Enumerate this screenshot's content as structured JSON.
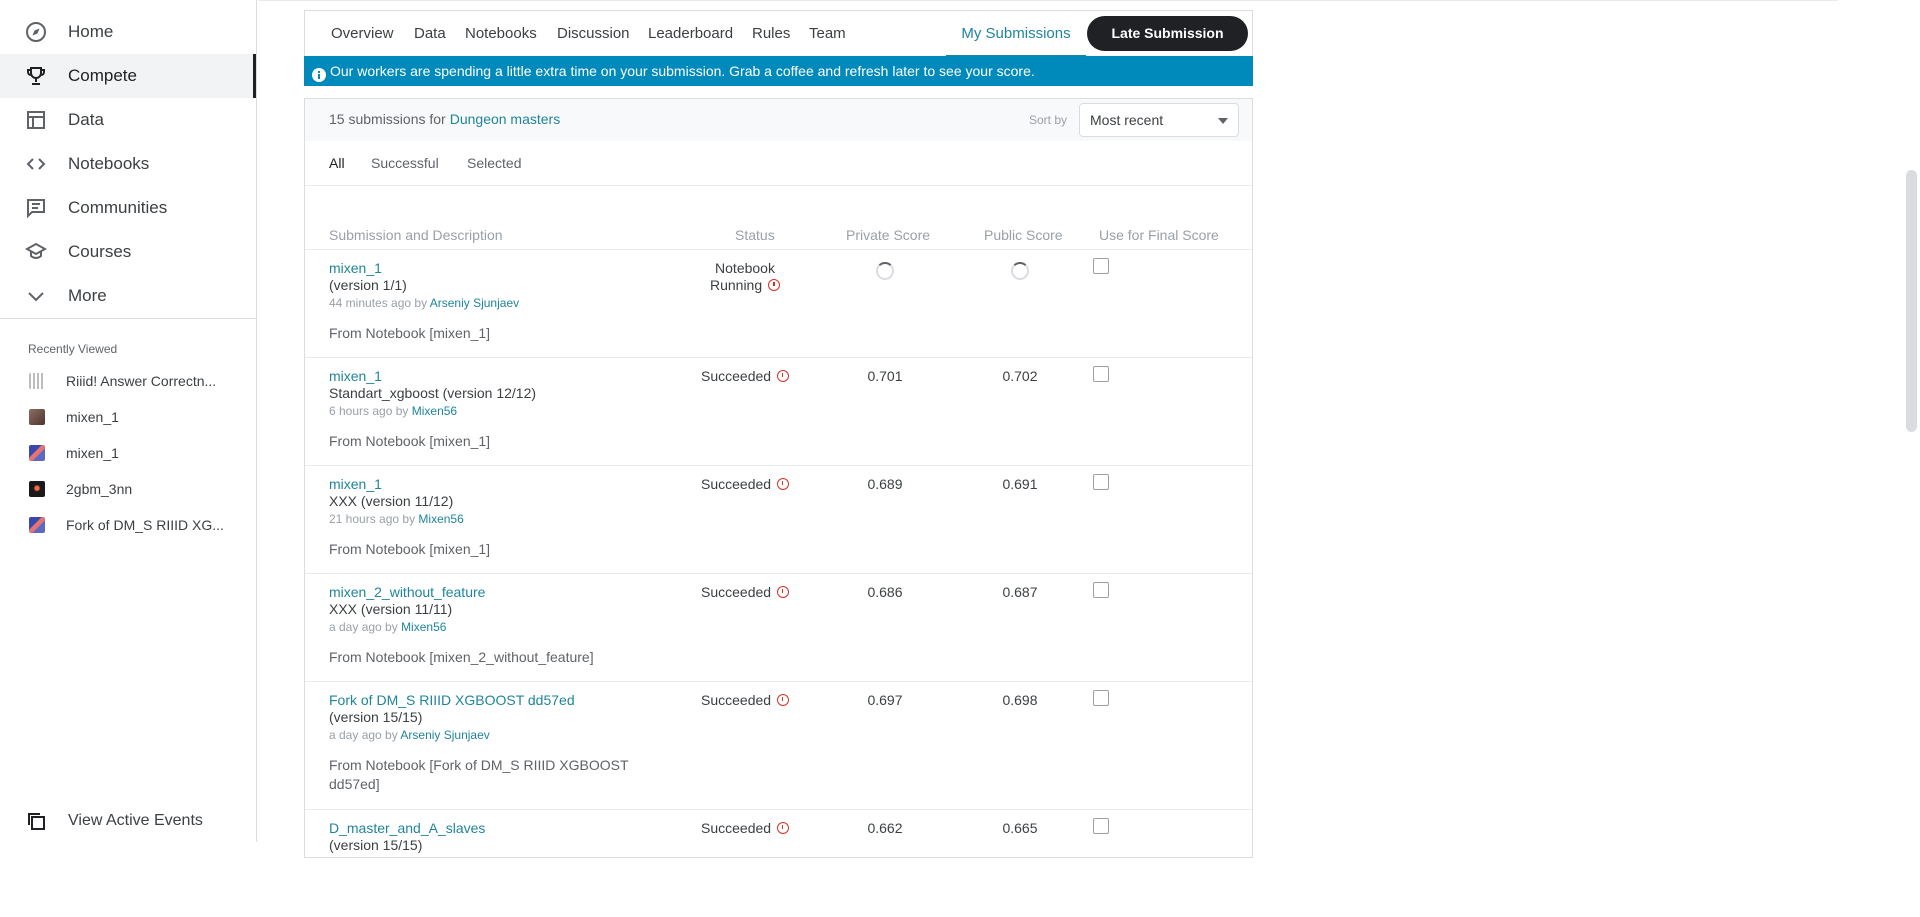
{
  "sidebar": {
    "nav": [
      {
        "label": "Home",
        "icon": "compass-icon"
      },
      {
        "label": "Compete",
        "icon": "trophy-icon"
      },
      {
        "label": "Data",
        "icon": "table-icon"
      },
      {
        "label": "Notebooks",
        "icon": "code-icon"
      },
      {
        "label": "Communities",
        "icon": "comment-icon"
      },
      {
        "label": "Courses",
        "icon": "school-icon"
      },
      {
        "label": "More",
        "icon": "chevron-down-icon"
      }
    ],
    "active_item": "Compete",
    "recent_title": "Recently Viewed",
    "recent": [
      {
        "label": "Riiid! Answer Correctn...",
        "thumb": "riiid-logo"
      },
      {
        "label": "mixen_1",
        "thumb": "portrait"
      },
      {
        "label": "mixen_1",
        "thumb": "pixel-avatar"
      },
      {
        "label": "2gbm_3nn",
        "thumb": "dark-avatar"
      },
      {
        "label": "Fork of DM_S RIIID XG...",
        "thumb": "pixel-avatar"
      }
    ],
    "view_events": "View Active Events"
  },
  "tabs": {
    "items": [
      "Overview",
      "Data",
      "Notebooks",
      "Discussion",
      "Leaderboard",
      "Rules",
      "Team"
    ],
    "my_submissions": "My Submissions",
    "late_submission": "Late Submission"
  },
  "banner": {
    "text": "Our workers are spending a little extra time on your submission. Grab a coffee and refresh later to see your score."
  },
  "panel": {
    "count_text": "15 submissions for",
    "competition": "Dungeon masters",
    "sort_label": "Sort by",
    "sort_value": "Most recent",
    "filters": [
      "All",
      "Successful",
      "Selected"
    ],
    "columns": [
      "Submission and Description",
      "Status",
      "Private Score",
      "Public Score",
      "Use for Final Score"
    ]
  },
  "submissions": [
    {
      "name": "mixen_1",
      "version": "(version 1/1)",
      "time": "44 minutes ago by",
      "author": "Arseniy Sjunjaev",
      "from": "From Notebook [mixen_1]",
      "status_line1": "Notebook",
      "status_line2": "Running",
      "private": "",
      "public": "",
      "pending": true
    },
    {
      "name": "mixen_1",
      "version": "Standart_xgboost (version 12/12)",
      "time": "6 hours ago by",
      "author": "Mixen56",
      "from": "From Notebook [mixen_1]",
      "status_line1": "Succeeded",
      "status_line2": "",
      "private": "0.701",
      "public": "0.702",
      "pending": false
    },
    {
      "name": "mixen_1",
      "version": "XXX (version 11/12)",
      "time": "21 hours ago by",
      "author": "Mixen56",
      "from": "From Notebook [mixen_1]",
      "status_line1": "Succeeded",
      "status_line2": "",
      "private": "0.689",
      "public": "0.691",
      "pending": false
    },
    {
      "name": "mixen_2_without_feature",
      "version": "XXX (version 11/11)",
      "time": "a day ago by",
      "author": "Mixen56",
      "from": "From Notebook [mixen_2_without_feature]",
      "status_line1": "Succeeded",
      "status_line2": "",
      "private": "0.686",
      "public": "0.687",
      "pending": false
    },
    {
      "name": "Fork of DM_S RIIID XGBOOST dd57ed",
      "version": "(version 15/15)",
      "time": "a day ago by",
      "author": "Arseniy Sjunjaev",
      "from": "From Notebook [Fork of DM_S RIIID XGBOOST dd57ed]",
      "status_line1": "Succeeded",
      "status_line2": "",
      "private": "0.697",
      "public": "0.698",
      "pending": false
    },
    {
      "name": "D_master_and_A_slaves",
      "version": "(version 15/15)",
      "time": "",
      "author": "",
      "from": "",
      "status_line1": "Succeeded",
      "status_line2": "",
      "private": "0.662",
      "public": "0.665",
      "pending": false
    }
  ],
  "colors": {
    "accent": "#20859b",
    "banner": "#008abc",
    "warning": "#d93025",
    "button": "#202124"
  }
}
